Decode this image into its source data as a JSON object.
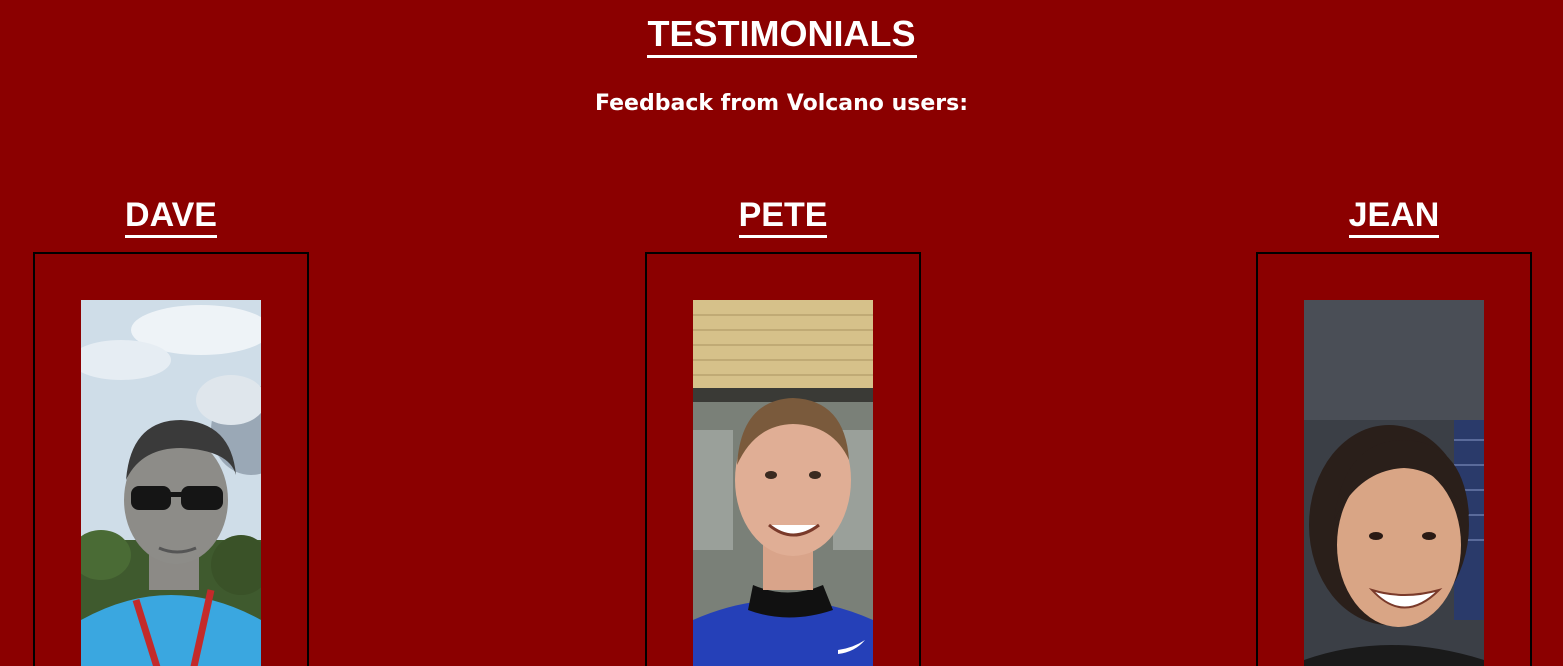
{
  "section": {
    "title": "TESTIMONIALS",
    "subtitle": "Feedback from Volcano users:"
  },
  "testimonials": [
    {
      "name": "DAVE",
      "photo_icon": "person-photo-dave"
    },
    {
      "name": "PETE",
      "photo_icon": "person-photo-pete"
    },
    {
      "name": "JEAN",
      "photo_icon": "person-photo-jean"
    }
  ],
  "colors": {
    "background": "#8b0000",
    "text": "#ffffff",
    "frame_border": "#000000"
  }
}
